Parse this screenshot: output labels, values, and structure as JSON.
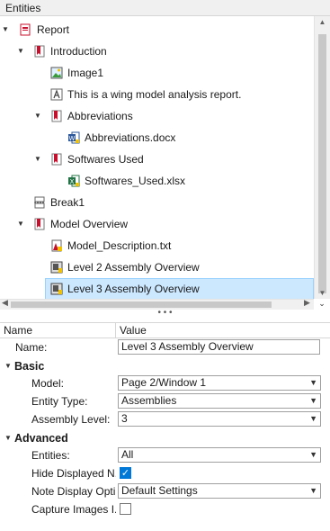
{
  "panel": {
    "title": "Entities"
  },
  "tree": [
    {
      "label": "Report",
      "icon": "report-icon",
      "expanded": true
    },
    {
      "label": "Introduction",
      "icon": "chapter-icon",
      "expanded": true
    },
    {
      "label": "Image1",
      "icon": "image-icon"
    },
    {
      "label": "This is a wing model analysis report.",
      "icon": "text-icon"
    },
    {
      "label": "Abbreviations",
      "icon": "chapter-icon",
      "expanded": true
    },
    {
      "label": "Abbreviations.docx",
      "icon": "word-file-icon"
    },
    {
      "label": "Softwares Used",
      "icon": "chapter-icon",
      "expanded": true
    },
    {
      "label": "Softwares_Used.xlsx",
      "icon": "excel-file-icon"
    },
    {
      "label": "Break1",
      "icon": "page-break-icon"
    },
    {
      "label": "Model Overview",
      "icon": "chapter-icon",
      "expanded": true
    },
    {
      "label": "Model_Description.txt",
      "icon": "text-file-icon"
    },
    {
      "label": "Level 2 Assembly Overview",
      "icon": "model-view-icon"
    },
    {
      "label": "Level 3 Assembly Overview",
      "icon": "model-view-icon",
      "selected": true
    }
  ],
  "props": {
    "col_name": "Name",
    "col_value": "Value",
    "name_label": "Name:",
    "name_value": "Level 3 Assembly Overview",
    "basic": {
      "title": "Basic",
      "model_label": "Model:",
      "model_value": "Page 2/Window 1",
      "entity_type_label": "Entity Type:",
      "entity_type_value": "Assemblies",
      "assembly_level_label": "Assembly Level:",
      "assembly_level_value": "3"
    },
    "advanced": {
      "title": "Advanced",
      "entities_label": "Entities:",
      "entities_value": "All",
      "hide_label": "Hide Displayed N...",
      "hide_checked": true,
      "note_label": "Note Display Opti...",
      "note_value": "Default Settings",
      "capture_label": "Capture Images I...",
      "capture_checked": false
    }
  },
  "colors": {
    "selection": "#cce8ff",
    "accent": "#0078d7",
    "chapter": "#c8102e"
  }
}
